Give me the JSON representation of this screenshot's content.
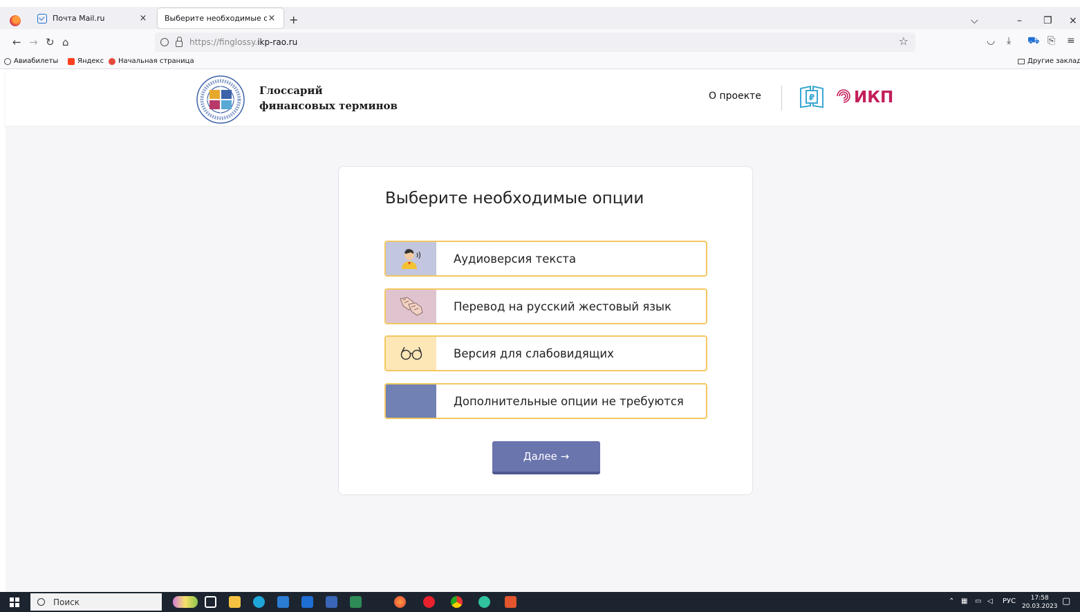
{
  "browser": {
    "tabs": [
      {
        "label": "Почта Mail.ru",
        "active": false
      },
      {
        "label": "Выберите необходимые опции",
        "active": true
      }
    ],
    "url_scheme": "https://finglossy.",
    "url_host": "ikp-rao.ru",
    "bookmarks": [
      {
        "label": "Авиабилеты",
        "icon": "globe-icon"
      },
      {
        "label": "Яндекс",
        "icon": "yandex-icon"
      },
      {
        "label": "Начальная страница",
        "icon": "start-page-icon"
      }
    ],
    "other_bookmarks": "Другие закладки"
  },
  "header": {
    "title_line1": "Глоссарий",
    "title_line2": "финансовых терминов",
    "about_link": "О проекте",
    "ikp_logo_text": "ИКП"
  },
  "card": {
    "title": "Выберите необходимые опции",
    "options": [
      {
        "label": "Аудиоверсия текста",
        "icon": "speaking-person-icon",
        "icon_bg": "#c2c6de"
      },
      {
        "label": "Перевод на русский жестовый язык",
        "icon": "sign-language-hands-icon",
        "icon_bg": "#dfc4d0"
      },
      {
        "label": "Версия для слабовидящих",
        "icon": "glasses-icon",
        "icon_bg": "#fde7b7"
      },
      {
        "label": "Дополнительные опции не требуются",
        "icon": "blank-icon",
        "icon_bg": "#7181b3"
      }
    ],
    "next_button": "Далее →"
  },
  "taskbar": {
    "search_placeholder": "Поиск",
    "language": "РУС",
    "time": "17:58",
    "date": "20.03.2023"
  },
  "colors": {
    "option_border": "#f4c761",
    "button": "#6a74ad",
    "ikp_brand": "#c41e5b"
  }
}
